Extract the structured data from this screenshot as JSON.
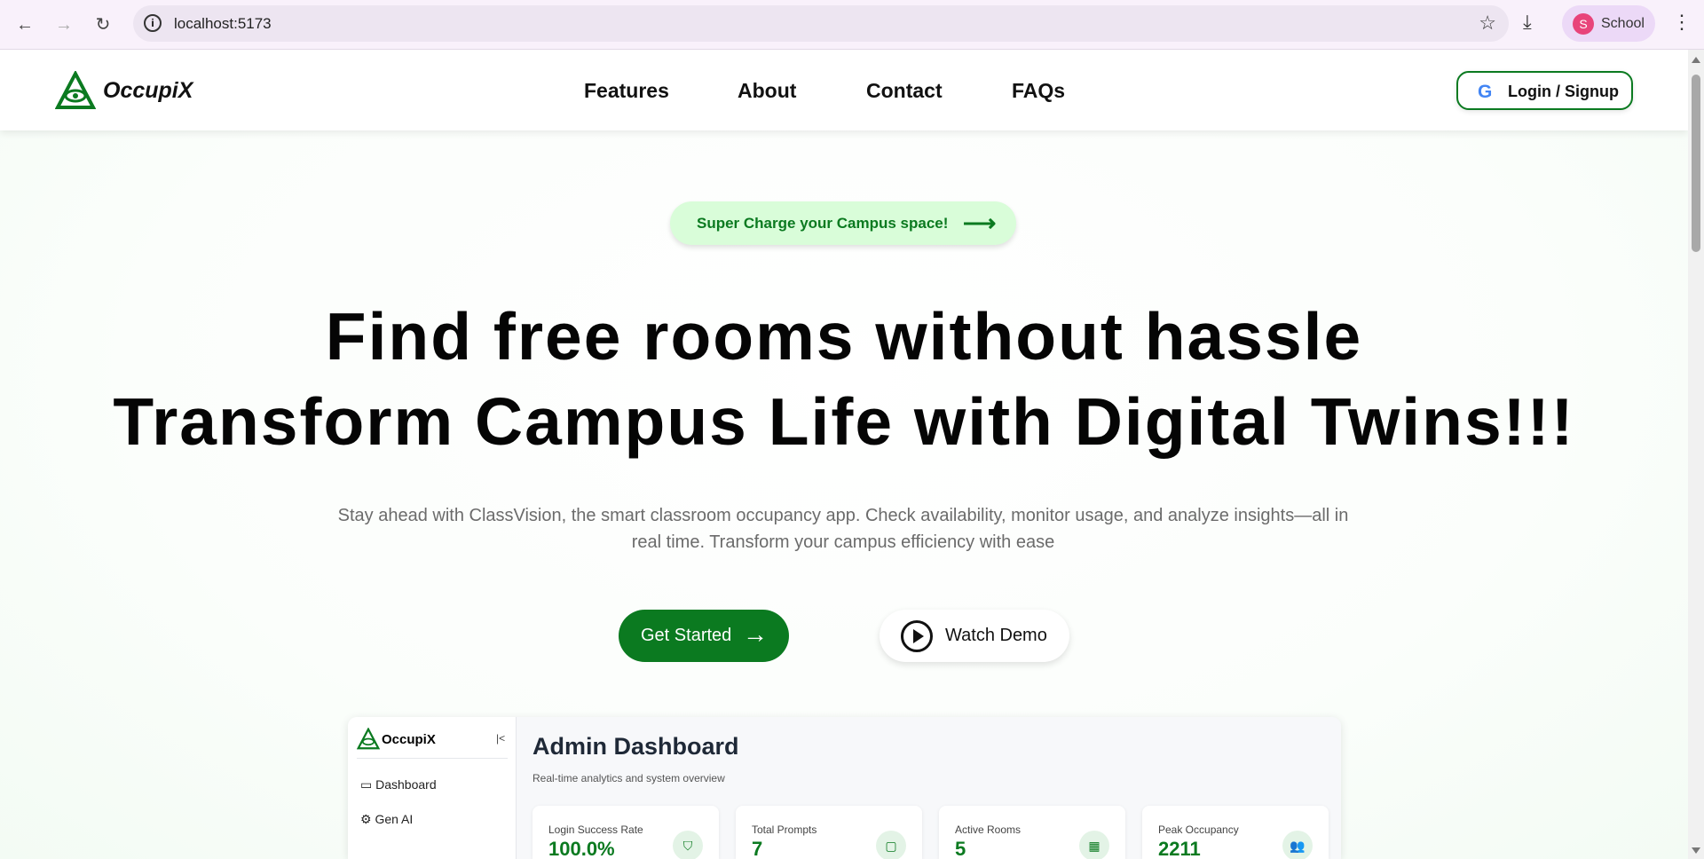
{
  "browser": {
    "url": "localhost:5173",
    "profile_initial": "S",
    "profile_name": "School"
  },
  "nav": {
    "brand": "OccupiX",
    "links": [
      "Features",
      "About",
      "Contact",
      "FAQs"
    ],
    "login": "Login / Signup"
  },
  "hero": {
    "badge": "Super Charge your Campus space!",
    "title_line1": "Find free rooms without hassle",
    "title_line2": "Transform Campus Life with Digital Twins!!!",
    "subtitle": "Stay ahead with ClassVision, the smart classroom occupancy app. Check availability, monitor usage, and analyze insights—all in real time. Transform your campus efficiency with ease",
    "get_started": "Get Started",
    "watch_demo": "Watch Demo"
  },
  "preview": {
    "brand": "OccupiX",
    "sidebar": [
      "Dashboard",
      "Gen AI"
    ],
    "title": "Admin Dashboard",
    "subtitle": "Real-time analytics and system overview",
    "cards": [
      {
        "label": "Login Success Rate",
        "value": "100.0%",
        "icon": "shield-icon"
      },
      {
        "label": "Total Prompts",
        "value": "7",
        "icon": "message-icon"
      },
      {
        "label": "Active Rooms",
        "value": "5",
        "icon": "building-icon"
      },
      {
        "label": "Peak Occupancy",
        "value": "2211",
        "icon": "users-icon"
      }
    ]
  },
  "colors": {
    "accent": "#0b7a20",
    "badge_bg": "#d9fdd9"
  }
}
